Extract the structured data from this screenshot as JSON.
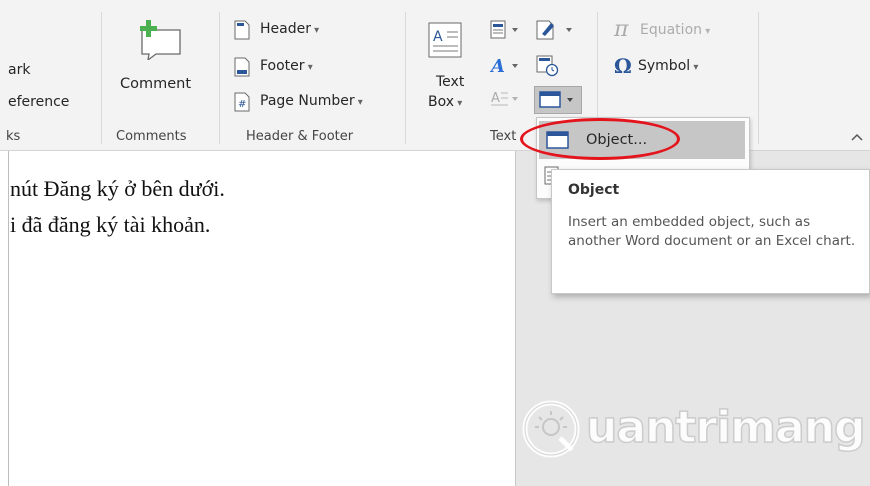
{
  "ribbon": {
    "links_group": {
      "item1": "ark",
      "item2": "eference",
      "label": "ks"
    },
    "comments_group": {
      "comment_button": "Comment",
      "label": "Comments"
    },
    "header_footer_group": {
      "header": "Header",
      "footer": "Footer",
      "page_number": "Page Number",
      "label": "Header & Footer"
    },
    "text_group": {
      "text_box_line1": "Text",
      "text_box_line2": "Box",
      "label": "Text"
    },
    "symbols_group": {
      "equation": "Equation",
      "symbol": "Symbol"
    }
  },
  "menu": {
    "object_item": "Object..."
  },
  "tooltip": {
    "title": "Object",
    "description": "Insert an embedded object, such as another Word document or an Excel chart."
  },
  "document": {
    "line1": "nút Đăng ký ở bên dưới.",
    "line2": "i đã đăng ký tài khoản."
  },
  "watermark": {
    "text": "uantrimang"
  },
  "colors": {
    "highlight_ellipse": "#e3141c",
    "accent_blue": "#2b579a",
    "menu_hover": "#c6c6c6"
  }
}
